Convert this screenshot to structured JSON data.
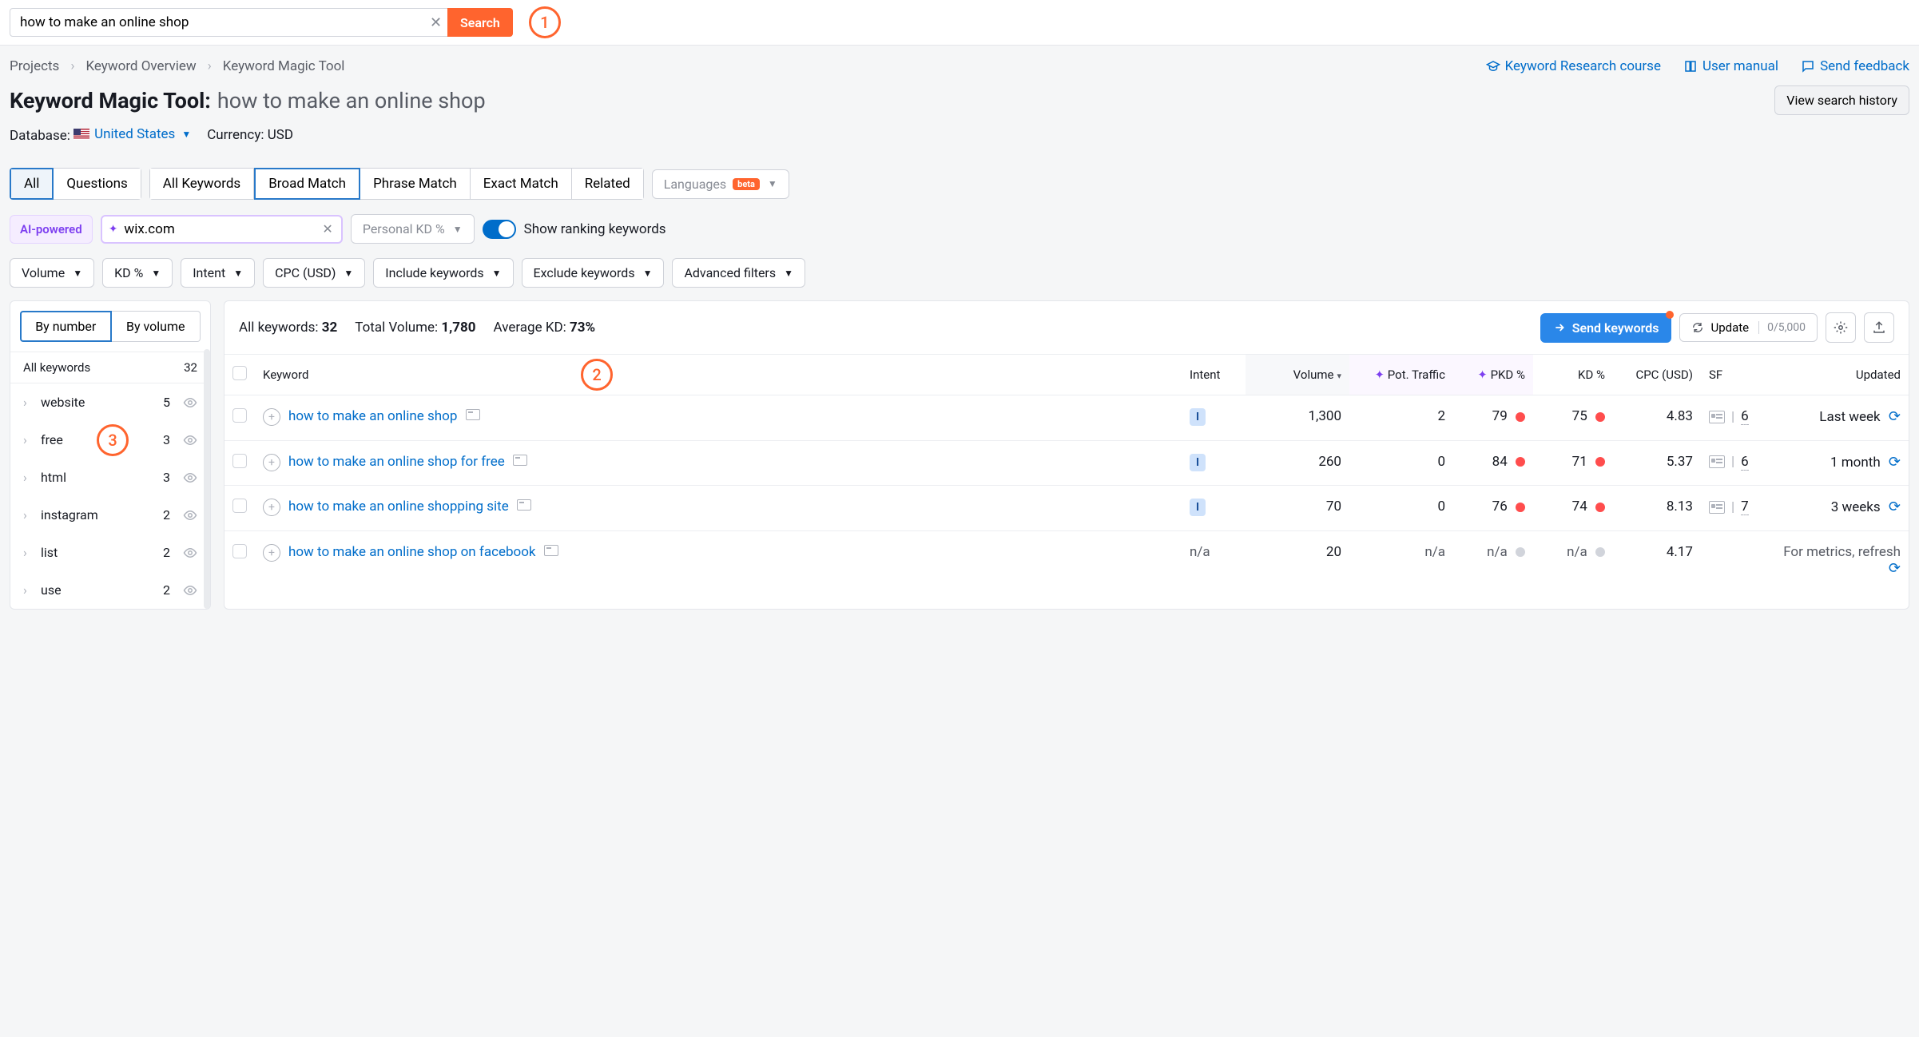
{
  "search": {
    "value": "how to make an online shop",
    "button": "Search"
  },
  "callouts": {
    "c1": "1",
    "c2": "2",
    "c3": "3"
  },
  "breadcrumbs": [
    "Projects",
    "Keyword Overview",
    "Keyword Magic Tool"
  ],
  "top_links": {
    "course": "Keyword Research course",
    "manual": "User manual",
    "feedback": "Send feedback"
  },
  "title": {
    "main": "Keyword Magic Tool:",
    "sub": "how to make an online shop",
    "history": "View search history"
  },
  "db": {
    "label": "Database:",
    "country": "United States",
    "currency_label": "Currency:",
    "currency": "USD"
  },
  "tabs_a": [
    "All",
    "Questions"
  ],
  "tabs_b": [
    "All Keywords",
    "Broad Match",
    "Phrase Match",
    "Exact Match",
    "Related"
  ],
  "lang": {
    "label": "Languages",
    "badge": "beta"
  },
  "ai": {
    "badge": "AI-powered",
    "domain": "wix.com",
    "pkd": "Personal KD %",
    "toggle_label": "Show ranking keywords"
  },
  "filters": [
    "Volume",
    "KD %",
    "Intent",
    "CPC (USD)",
    "Include keywords",
    "Exclude keywords",
    "Advanced filters"
  ],
  "sidebar": {
    "tabs": [
      "By number",
      "By volume"
    ],
    "all_label": "All keywords",
    "all_count": "32",
    "items": [
      {
        "label": "website",
        "count": "5"
      },
      {
        "label": "free",
        "count": "3"
      },
      {
        "label": "html",
        "count": "3"
      },
      {
        "label": "instagram",
        "count": "2"
      },
      {
        "label": "list",
        "count": "2"
      },
      {
        "label": "use",
        "count": "2"
      }
    ]
  },
  "summary": {
    "allkw_l": "All keywords: ",
    "allkw_v": "32",
    "vol_l": "Total Volume: ",
    "vol_v": "1,780",
    "kd_l": "Average KD: ",
    "kd_v": "73%",
    "send": "Send keywords",
    "update": "Update",
    "counter": "0/5,000"
  },
  "columns": {
    "kw": "Keyword",
    "intent": "Intent",
    "volume": "Volume",
    "pot": "Pot. Traffic",
    "pkd": "PKD %",
    "kd": "KD %",
    "cpc": "CPC (USD)",
    "sf": "SF",
    "upd": "Updated"
  },
  "rows": [
    {
      "kw": "how to make an online shop",
      "intent": "I",
      "vol": "1,300",
      "pot": "2",
      "pkd": "79",
      "pkd_c": "red",
      "kd": "75",
      "kd_c": "red",
      "cpc": "4.83",
      "sf": "6",
      "upd": "Last week",
      "na": false
    },
    {
      "kw": "how to make an online shop for free",
      "intent": "I",
      "vol": "260",
      "pot": "0",
      "pkd": "84",
      "pkd_c": "red",
      "kd": "71",
      "kd_c": "red",
      "cpc": "5.37",
      "sf": "6",
      "upd": "1 month",
      "na": false
    },
    {
      "kw": "how to make an online shopping site",
      "intent": "I",
      "vol": "70",
      "pot": "0",
      "pkd": "76",
      "pkd_c": "red",
      "kd": "74",
      "kd_c": "red",
      "cpc": "8.13",
      "sf": "7",
      "upd": "3 weeks",
      "na": false
    },
    {
      "kw": "how to make an online shop on facebook",
      "intent": "n/a",
      "vol": "20",
      "pot": "n/a",
      "pkd": "n/a",
      "pkd_c": "gray",
      "kd": "n/a",
      "kd_c": "gray",
      "cpc": "4.17",
      "sf": "",
      "upd": "For metrics, refresh",
      "na": true
    }
  ]
}
